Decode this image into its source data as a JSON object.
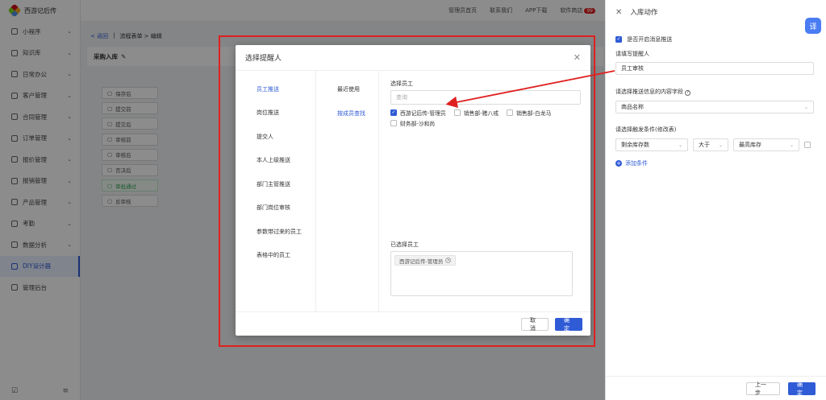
{
  "app": {
    "name": "西游记后传"
  },
  "sidebar": {
    "items": [
      {
        "label": "小程序",
        "icon": "grid-icon",
        "chevron": "⌄"
      },
      {
        "label": "知识库",
        "icon": "book-icon",
        "chevron": "⌄"
      },
      {
        "label": "日常办公",
        "icon": "calendar-icon",
        "chevron": "⌄"
      },
      {
        "label": "客户管理",
        "icon": "user-icon",
        "chevron": "⌄"
      },
      {
        "label": "合同管理",
        "icon": "contract-icon",
        "chevron": "⌄"
      },
      {
        "label": "订单管理",
        "icon": "order-icon",
        "chevron": "⌄"
      },
      {
        "label": "报价管理",
        "icon": "quote-icon",
        "chevron": "⌄"
      },
      {
        "label": "报销管理",
        "icon": "expense-icon",
        "chevron": "⌄"
      },
      {
        "label": "产品管理",
        "icon": "product-icon",
        "chevron": "⌄"
      },
      {
        "label": "考勤",
        "icon": "clock-icon",
        "chevron": "⌄"
      },
      {
        "label": "数据分析",
        "icon": "chart-icon",
        "chevron": "⌄"
      },
      {
        "label": "DIY设计器",
        "icon": "design-icon",
        "chevron": ""
      },
      {
        "label": "管理后台",
        "icon": "settings-icon",
        "chevron": ""
      }
    ],
    "foot_left": "☑",
    "foot_right": "≡"
  },
  "topbar": {
    "items": [
      "管理员首页",
      "联系我们",
      "APP下载",
      "软件商店"
    ],
    "badge": "99"
  },
  "content": {
    "back": "< 返回",
    "crumb_sep": "|",
    "crumb": "流程表单 > 编辑",
    "flow_title": "采购入库",
    "flow_nodes": [
      {
        "label": "保存后"
      },
      {
        "label": "提交前"
      },
      {
        "label": "提交后"
      },
      {
        "label": "审核前"
      },
      {
        "label": "审核后"
      },
      {
        "label": "否决后"
      },
      {
        "label": "审批通过"
      },
      {
        "label": "反审核"
      }
    ]
  },
  "drawer": {
    "title": "入库动作",
    "translate": "译",
    "enable_push": {
      "label": "是否开启消息推送",
      "checked": true
    },
    "reminder_label": "请填写提醒人",
    "reminder_value": "员工审核",
    "content_label": "请选择推送信息的内容字段",
    "content_value": "商品名称",
    "cond_label": "请选择触发条件(修改表)",
    "cond": {
      "field": "剩余库存数",
      "op": "大于",
      "target": "最高库存"
    },
    "add_cond": "添加条件",
    "prev_btn": "上一步",
    "ok_btn": "确定"
  },
  "modal": {
    "title": "选择提醒人",
    "col1": [
      {
        "label": "员工推送",
        "active": true
      },
      {
        "label": "岗位推送",
        "active": false
      },
      {
        "label": "提交人",
        "active": false
      },
      {
        "label": "本人上级推送",
        "active": false
      },
      {
        "label": "部门主管推送",
        "active": false
      },
      {
        "label": "部门岗位审核",
        "active": false
      },
      {
        "label": "参数带过来的员工",
        "active": false
      },
      {
        "label": "表格中的员工",
        "active": false
      }
    ],
    "col2": [
      {
        "label": "最近使用",
        "active": false
      },
      {
        "label": "按成员查找",
        "active": true
      }
    ],
    "select_label": "选择员工",
    "search_placeholder": "查询",
    "employees": [
      {
        "label": "西游记后传-管理员",
        "checked": true
      },
      {
        "label": "销售部-猪八戒",
        "checked": false
      },
      {
        "label": "销售部-白龙马",
        "checked": false
      },
      {
        "label": "财务部-沙和尚",
        "checked": false
      }
    ],
    "selected_label": "已选择员工",
    "selected": [
      "西游记后传-管理员"
    ],
    "cancel_btn": "取 消",
    "ok_btn": "确 定"
  },
  "colors": {
    "accent": "#2f5bd6",
    "annotation": "#e02020"
  }
}
